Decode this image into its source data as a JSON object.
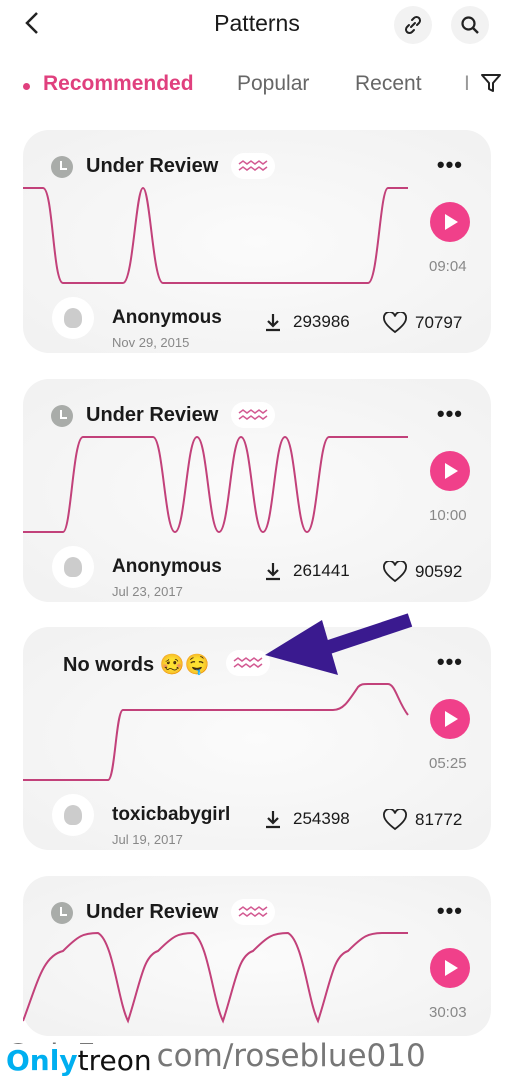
{
  "header": {
    "title": "Patterns",
    "back_icon": "chevron-left-icon",
    "link_icon": "link-icon",
    "search_icon": "search-icon"
  },
  "tabs": [
    {
      "label": "Recommended",
      "active": true
    },
    {
      "label": "Popular"
    },
    {
      "label": "Recent"
    },
    {
      "label": "I"
    }
  ],
  "filter_icon": "filter-icon",
  "accent": "#e0407e",
  "cards": [
    {
      "title": "Under Review",
      "duration": "09:04",
      "author": "Anonymous",
      "date": "Nov 29, 2015",
      "downloads": "293986",
      "likes": "70797"
    },
    {
      "title": "Under Review",
      "duration": "10:00",
      "author": "Anonymous",
      "date": "Jul 23, 2017",
      "downloads": "261441",
      "likes": "90592"
    },
    {
      "title": "No words 🥴🤤",
      "duration": "05:25",
      "author": "toxicbabygirl",
      "date": "Jul 19, 2017",
      "downloads": "254398",
      "likes": "81772"
    },
    {
      "title": "Under Review",
      "duration": "30:03",
      "author": "",
      "date": "",
      "downloads": "",
      "likes": ""
    }
  ],
  "watermark": {
    "logo_a": "Only",
    "logo_b": "treon",
    "text": "OnlyFans.com/roseblue010"
  }
}
